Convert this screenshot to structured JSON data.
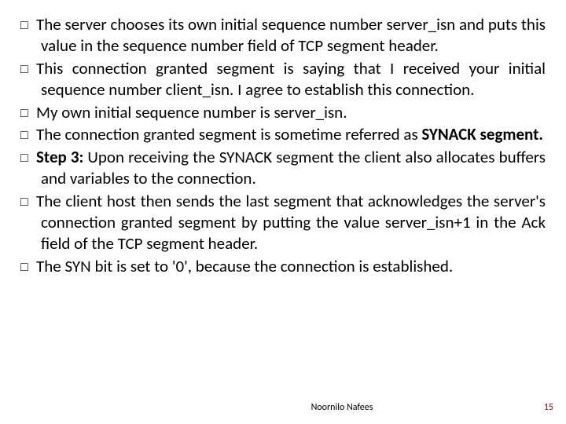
{
  "bullets": [
    {
      "pre": "The server chooses its own initial sequence number server_isn and puts this value in the sequence number field of TCP segment header.",
      "bold": "",
      "post": ""
    },
    {
      "pre": "This connection granted segment is saying that I received your initial sequence number client_isn. I agree to establish this connection.",
      "bold": "",
      "post": ""
    },
    {
      "pre": "My own initial sequence number is server_isn.",
      "bold": "",
      "post": ""
    },
    {
      "pre": "The connection granted segment is sometime referred as ",
      "bold": "SYNACK segment.",
      "post": ""
    },
    {
      "pre": "",
      "bold": "Step 3:",
      "post": " Upon receiving the SYNACK segment the client also allocates buffers and variables to the connection."
    },
    {
      "pre": "The client host then sends the last segment that acknowledges the server's connection granted segment by putting the value server_isn+1 in the Ack field of the TCP segment header.",
      "bold": "",
      "post": ""
    },
    {
      "pre": "The SYN bit is set to '0', because the connection is established.",
      "bold": "",
      "post": ""
    }
  ],
  "footer": {
    "author": "Noornilo Nafees",
    "page": "15"
  },
  "glyph": "□ "
}
